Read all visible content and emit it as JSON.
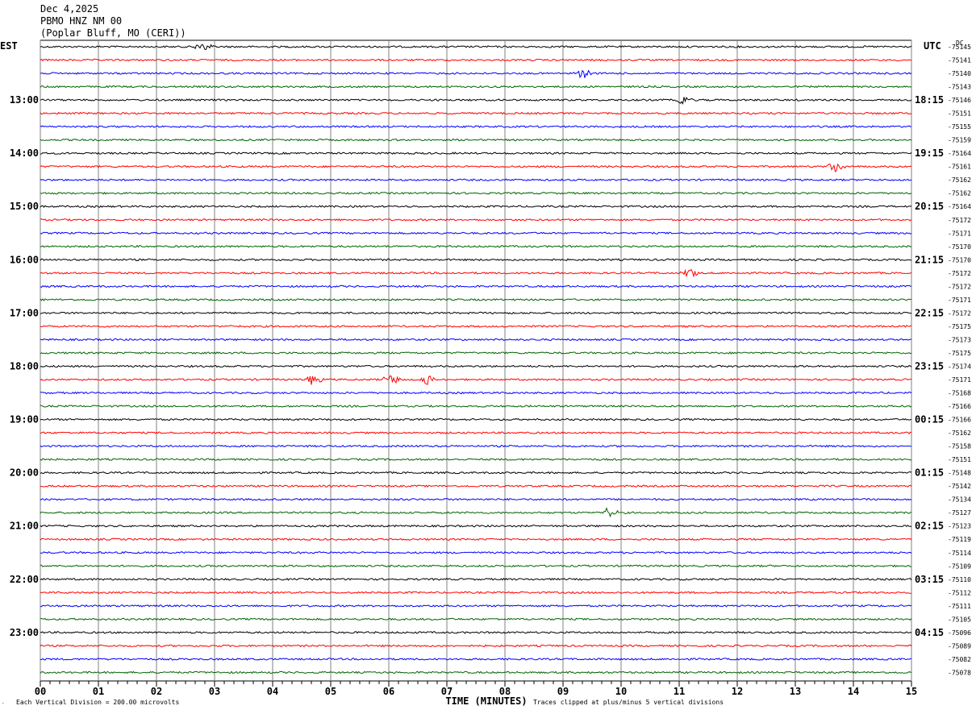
{
  "header": {
    "date": "Dec 4,2025",
    "station": "PBMO HNZ NM 00",
    "location": "(Poplar Bluff, MO (CERI))"
  },
  "chart_data": {
    "type": "line",
    "title": "Dec 4,2025 PBMO HNZ NM 00 (Poplar Bluff, MO (CERI))",
    "xlabel": "TIME (MINUTES)",
    "x_ticks": [
      "00",
      "01",
      "02",
      "03",
      "04",
      "05",
      "06",
      "07",
      "08",
      "09",
      "10",
      "11",
      "12",
      "13",
      "14",
      "15"
    ],
    "xlim": [
      0,
      15
    ],
    "left_timezone": "EST",
    "right_timezone": "UTC",
    "dc_label": "DC",
    "left_hour_labels": [
      "13:00",
      "14:00",
      "15:00",
      "16:00",
      "17:00",
      "18:00",
      "19:00",
      "20:00",
      "21:00",
      "22:00",
      "23:00"
    ],
    "right_hour_labels": [
      "18:15",
      "19:15",
      "20:15",
      "21:15",
      "22:15",
      "23:15",
      "00:15",
      "01:15",
      "02:15",
      "03:15",
      "04:15"
    ],
    "trace_colors": [
      "#000000",
      "#ff0000",
      "#0000ff",
      "#006400"
    ],
    "dc_offsets": [
      "-75145",
      "-75141",
      "-75140",
      "-75143",
      "-75146",
      "-75151",
      "-75155",
      "-75159",
      "-75164",
      "-75161",
      "-75162",
      "-75162",
      "-75164",
      "-75172",
      "-75171",
      "-75170",
      "-75170",
      "-75172",
      "-75172",
      "-75171",
      "-75172",
      "-75175",
      "-75173",
      "-75175",
      "-75174",
      "-75171",
      "-75168",
      "-75166",
      "-75166",
      "-75162",
      "-75158",
      "-75151",
      "-75148",
      "-75142",
      "-75134",
      "-75127",
      "-75123",
      "-75119",
      "-75114",
      "-75109",
      "-75110",
      "-75112",
      "-75111",
      "-75105",
      "-75096",
      "-75089",
      "-75082",
      "-75078"
    ],
    "events": [
      {
        "trace": 0,
        "minute": 2.8
      },
      {
        "trace": 2,
        "minute": 9.35
      },
      {
        "trace": 4,
        "minute": 11.1
      },
      {
        "trace": 9,
        "minute": 13.7
      },
      {
        "trace": 17,
        "minute": 11.2
      },
      {
        "trace": 25,
        "minute": 4.7
      },
      {
        "trace": 25,
        "minute": 6.05
      },
      {
        "trace": 25,
        "minute": 6.65
      },
      {
        "trace": 35,
        "minute": 9.8
      }
    ],
    "grid": true
  },
  "footer": {
    "scale_note": "Each Vertical Division =  200.00 microvolts",
    "clip_note": "Traces clipped at plus/minus 5 vertical divisions"
  }
}
